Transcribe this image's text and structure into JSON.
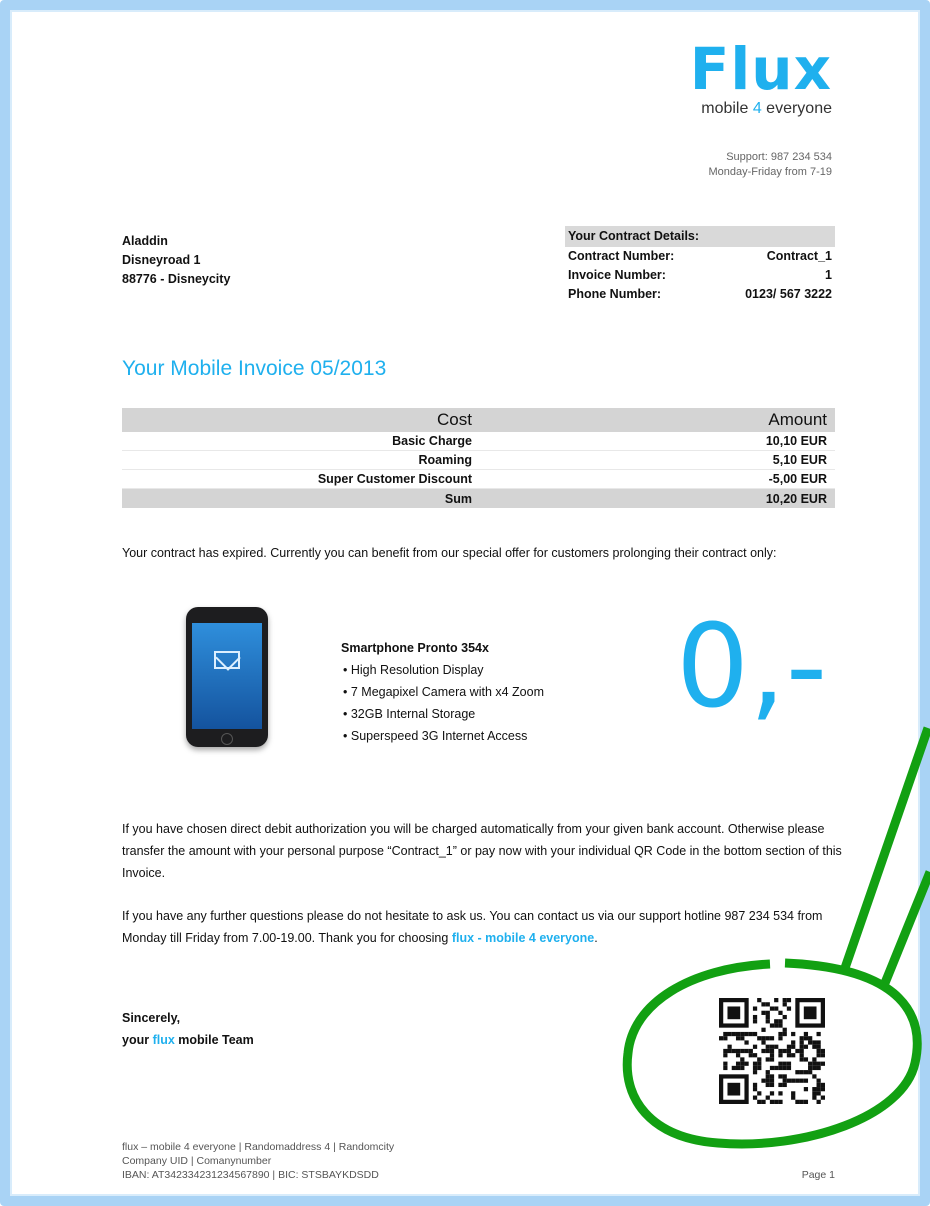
{
  "logo": {
    "word": "Flux",
    "tag_pre": "mobile ",
    "tag_four": "4",
    "tag_post": " everyone"
  },
  "support": {
    "line1": "Support: 987 234 534",
    "line2": "Monday-Friday from 7-19"
  },
  "address": {
    "name": "Aladdin",
    "street": "Disneyroad 1",
    "city": "88776 - Disneycity"
  },
  "contract": {
    "heading": "Your Contract Details:",
    "rows": [
      {
        "label": "Contract Number:",
        "value": "Contract_1"
      },
      {
        "label": "Invoice Number:",
        "value": "1"
      },
      {
        "label": "Phone Number:",
        "value": "0123/ 567 3222"
      }
    ]
  },
  "invoice_title": "Your Mobile Invoice 05/2013",
  "cost_table": {
    "headers": [
      "Cost",
      "Amount"
    ],
    "rows": [
      {
        "label": "Basic Charge",
        "amount": "10,10 EUR"
      },
      {
        "label": "Roaming",
        "amount": "5,10 EUR"
      },
      {
        "label": "Super Customer Discount",
        "amount": "-5,00 EUR"
      }
    ],
    "sum": {
      "label": "Sum",
      "amount": "10,20 EUR"
    }
  },
  "offer_text": "Your contract has expired. Currently you can benefit from our special offer for customers prolonging their contract only:",
  "product": {
    "name": "Smartphone Pronto 354x",
    "features": [
      "High Resolution Display",
      "7 Megapixel Camera with x4 Zoom",
      "32GB Internal Storage",
      "Superspeed 3G Internet  Access"
    ],
    "price": "0,-"
  },
  "payment_text": "If you have chosen direct debit authorization you will be charged automatically from your given bank account. Otherwise please transfer the amount with your personal purpose “Contract_1”  or pay now with your individual QR Code in the bottom section of this Invoice.",
  "support_text": {
    "pre": "If you have any further questions please do not hesitate to ask us. You can contact us via our support hotline 987 234 534 from Monday till Friday from 7.00-19.00. Thank you for choosing ",
    "brand": "flux - mobile 4 everyone",
    "post": "."
  },
  "closing": {
    "line1": "Sincerely,",
    "pre": "your ",
    "brand": "flux",
    "post": " mobile Team"
  },
  "footer": {
    "line1": "flux – mobile 4 everyone | Randomaddress 4 | Randomcity",
    "line2": "Company UID | Comanynumber",
    "line3": "IBAN: AT342334231234567890 | BIC: STSBAYKDSDD"
  },
  "page_label": "Page 1",
  "colors": {
    "brand": "#1fb0ee",
    "callout": "#12a012",
    "frame": "#a9d3f5"
  }
}
